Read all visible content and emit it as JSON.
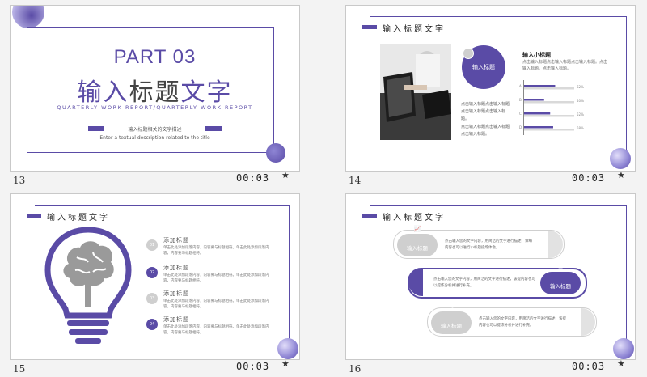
{
  "colors": {
    "accent": "#5a4ba6",
    "gray": "#cfcfcf",
    "background": "#f3f3f3"
  },
  "slides": [
    {
      "number": "13",
      "time": "00:03",
      "marker": "★",
      "part": "PART 03",
      "title_a": "输入",
      "title_b": "标题",
      "title_c": "文字",
      "subtitle": "QUARTERLY WORK REPORT/QUARTERLY WORK REPORT",
      "desc_cn": "输入标题相关的文字描述",
      "desc_en": "Enter a textual description related to the title"
    },
    {
      "number": "14",
      "time": "00:03",
      "marker": "★",
      "header": "输入标题文字",
      "circle_label": "输入标题",
      "paragraph1": "点击输入标题点击输入标题点击输入标题点击输入标题。",
      "paragraph2": "点击输入标题点击输入标题点击输入标题。",
      "subtitle": "输入小标题",
      "subtext": "点击输入标题点击输入标题点击输入标题。点击输入标题。点击输入标题。",
      "bars": [
        {
          "label": "A",
          "value": 0.62,
          "value_text": "62%"
        },
        {
          "label": "B",
          "value": 0.4,
          "value_text": "40%"
        },
        {
          "label": "C",
          "value": 0.52,
          "value_text": "52%"
        },
        {
          "label": "D",
          "value": 0.58,
          "value_text": "58%"
        }
      ]
    },
    {
      "number": "15",
      "time": "00:03",
      "marker": "★",
      "header": "输入标题文字",
      "items": [
        {
          "num": "01",
          "title": "添加标题",
          "text": "单击此处添加段落内容，内容要与标题相符。单击此处添加段落内容，内容要与标题相符。",
          "active": false
        },
        {
          "num": "02",
          "title": "添加标题",
          "text": "单击此处添加段落内容，内容要与标题相符。单击此处添加段落内容，内容要与标题相符。",
          "active": true
        },
        {
          "num": "03",
          "title": "添加标题",
          "text": "单击此处添加段落内容，内容要与标题相符。单击此处添加段落内容，内容要与标题相符。",
          "active": false
        },
        {
          "num": "04",
          "title": "添加标题",
          "text": "单击此处添加段落内容，内容要与标题相符。单击此处添加段落内容，内容要与标题相符。",
          "active": true
        }
      ]
    },
    {
      "number": "16",
      "time": "00:03",
      "marker": "★",
      "header": "输入标题文字",
      "rows": [
        {
          "label": "输入标题",
          "icon": "chart-icon",
          "text": "点击输入您的文字内容，用简洁的文字进行描述，详细内容也可以进行小标题提炼体会。",
          "active": false
        },
        {
          "label": "输入标题",
          "icon": "mail-icon",
          "text": "点击输入您的文字内容，用简洁的文字进行描述，该提内容也可以提炼分析并进行补充。",
          "active": true
        },
        {
          "label": "输入标题",
          "icon": "share-icon",
          "text": "点击输入您的文字内容，用简洁的文字进行描述，该提内容也可以提炼分析并进行补充。",
          "active": false
        }
      ]
    }
  ]
}
